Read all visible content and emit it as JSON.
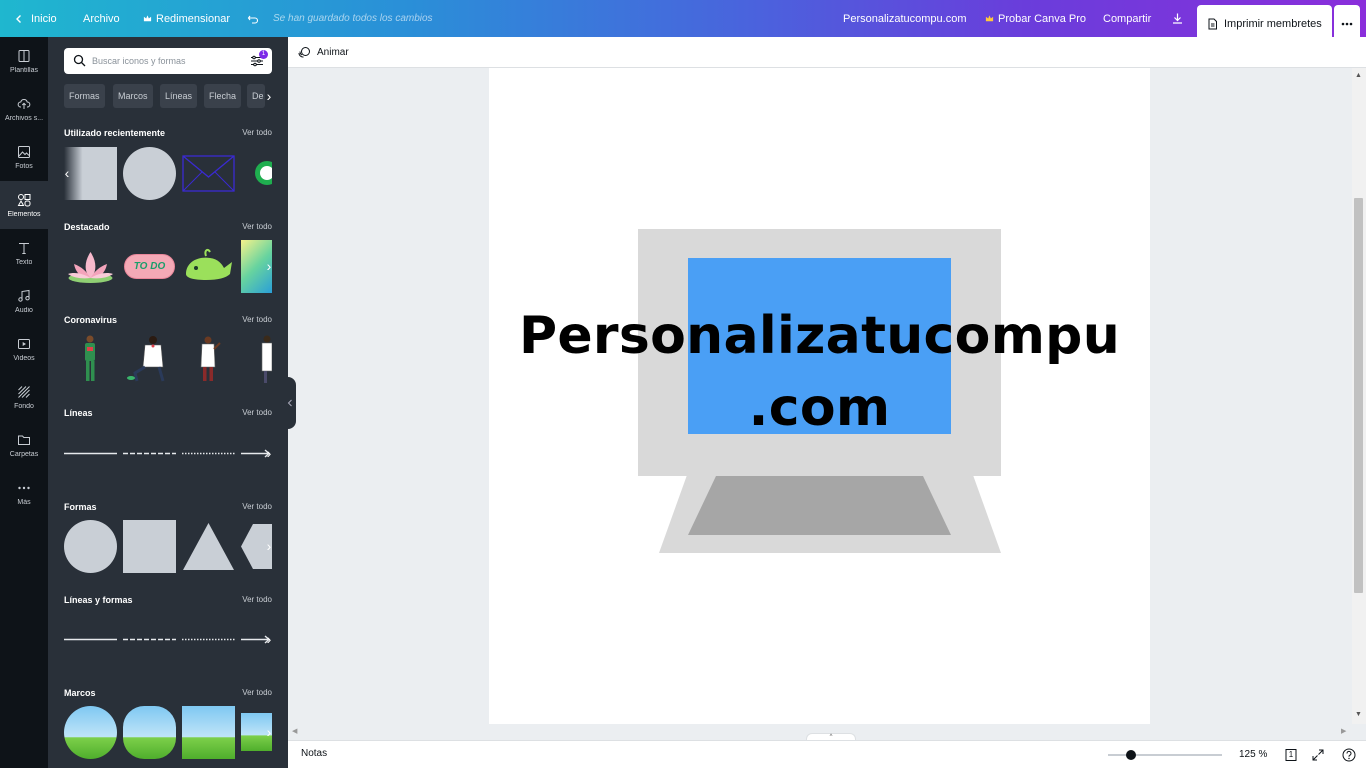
{
  "topbar": {
    "home": "Inicio",
    "file": "Archivo",
    "resize": "Redimensionar",
    "saved_status": "Se han guardado todos los cambios",
    "design_title": "Personalizatucompu.com",
    "try_pro": "Probar Canva Pro",
    "share": "Compartir",
    "print": "Imprimir membretes"
  },
  "rail": [
    {
      "label": "Plantillas",
      "icon": "template-icon"
    },
    {
      "label": "Archivos s...",
      "icon": "upload-cloud-icon"
    },
    {
      "label": "Fotos",
      "icon": "photo-icon"
    },
    {
      "label": "Elementos",
      "icon": "elements-icon",
      "active": true
    },
    {
      "label": "Texto",
      "icon": "text-icon"
    },
    {
      "label": "Audio",
      "icon": "music-icon"
    },
    {
      "label": "Videos",
      "icon": "video-icon"
    },
    {
      "label": "Fondo",
      "icon": "background-icon"
    },
    {
      "label": "Carpetas",
      "icon": "folder-icon"
    },
    {
      "label": "Más",
      "icon": "more-icon"
    }
  ],
  "panel": {
    "search_placeholder": "Buscar iconos y formas",
    "filter_badge": "1",
    "chips": [
      "Formas",
      "Marcos",
      "Líneas",
      "Flecha",
      "De"
    ],
    "see_all": "Ver todo",
    "sections": [
      {
        "title": "Utilizado recientemente"
      },
      {
        "title": "Destacado"
      },
      {
        "title": "Coronavirus"
      },
      {
        "title": "Líneas"
      },
      {
        "title": "Formas"
      },
      {
        "title": "Líneas y formas"
      },
      {
        "title": "Marcos"
      }
    ],
    "sticker_text": "TO DO"
  },
  "toolbar": {
    "animate": "Animar"
  },
  "canvas": {
    "headline_line1": "Personalizatucompu",
    "headline_line2": ".com"
  },
  "bottombar": {
    "notes": "Notas",
    "zoom": "125 %",
    "zoom_fraction": 0.2,
    "page_count": "1"
  },
  "colors": {
    "screen_blue": "#4a9ff5",
    "monitor_gray": "#d9d9d9",
    "stand_gray": "#a6a6a6",
    "accent_purple": "#7d2ae8"
  }
}
